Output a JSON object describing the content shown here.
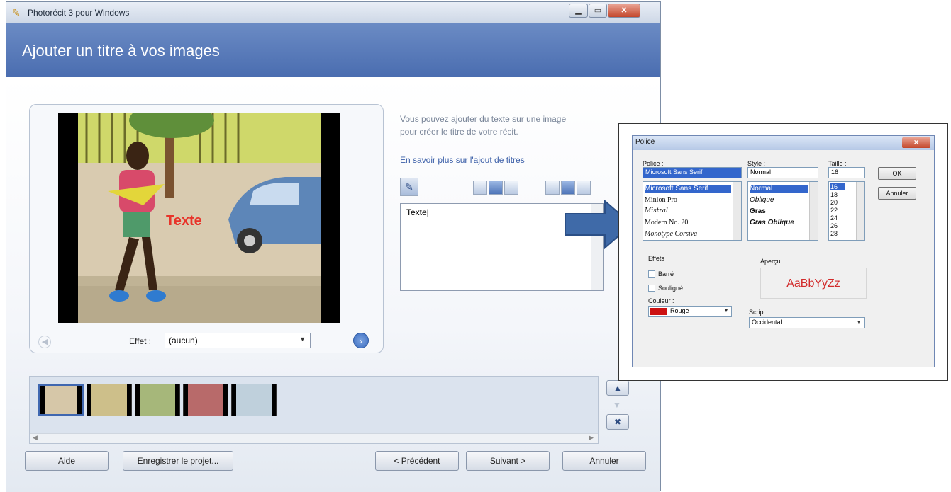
{
  "window": {
    "title": "Photorécit 3 pour Windows",
    "heading": "Ajouter un titre à vos images",
    "min": "▁",
    "max": "▭",
    "close": "✕"
  },
  "editor": {
    "preview_text": "Texte",
    "effect_label": "Effet :",
    "effect_value": "(aucun)",
    "help_text": "Vous pouvez ajouter du texte sur une image pour créer le titre de votre récit.",
    "help_link": "En savoir plus sur l'ajout de titres",
    "text_value": "Texte|"
  },
  "filmstrip": {
    "thumbnail_count": 5,
    "selected_index": 0
  },
  "buttons": {
    "help": "Aide",
    "save": "Enregistrer le projet...",
    "prev": "< Précédent",
    "next": "Suivant >",
    "cancel": "Annuler"
  },
  "font_dialog": {
    "title": "Police",
    "font_label": "Police :",
    "font_value": "Microsoft Sans Serif",
    "fonts": [
      "Microsoft Sans Serif",
      "Minion Pro",
      "Mistral",
      "Modern No. 20",
      "Monotype Corsiva"
    ],
    "style_label": "Style :",
    "style_value": "Normal",
    "styles": [
      "Normal",
      "Oblique",
      "Gras",
      "Gras Oblique"
    ],
    "size_label": "Taille :",
    "size_value": "16",
    "sizes": [
      "16",
      "18",
      "20",
      "22",
      "24",
      "26",
      "28"
    ],
    "ok": "OK",
    "cancel": "Annuler",
    "effects_label": "Effets",
    "strike": "Barré",
    "underline": "Souligné",
    "color_label": "Couleur :",
    "color_value": "Rouge",
    "color_hex": "#cc1111",
    "preview_label": "Aperçu",
    "preview_text": "AaBbYyZz",
    "script_label": "Script :",
    "script_value": "Occidental"
  },
  "colors": {
    "banner": "#4a6db0",
    "accent": "#3f67b0",
    "arrow": "#3f6aa8"
  }
}
